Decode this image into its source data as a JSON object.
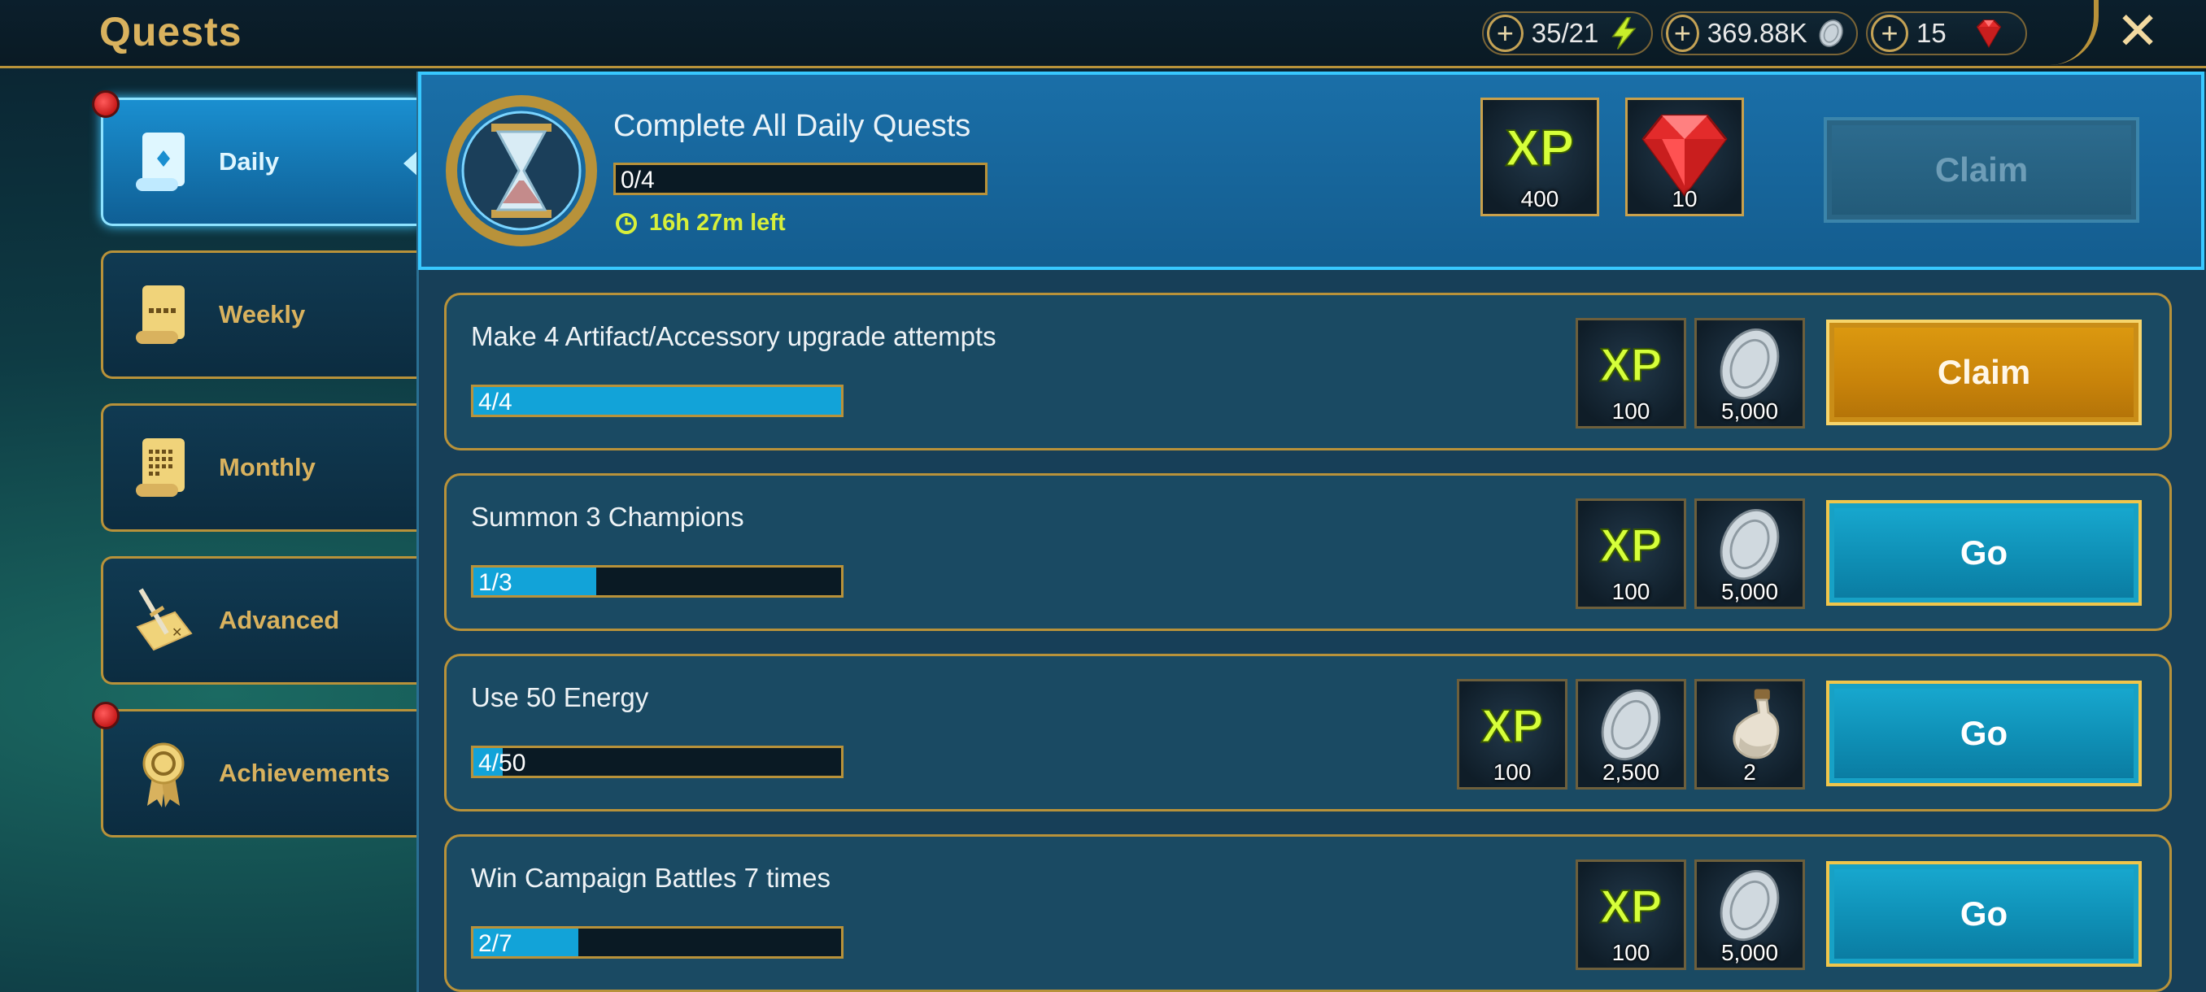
{
  "header": {
    "title": "Quests",
    "currencies": [
      {
        "value": "35/21",
        "icon": "energy-bolt-icon"
      },
      {
        "value": "369.88K",
        "icon": "silver-coin-icon"
      },
      {
        "value": "15",
        "icon": "ruby-gem-icon"
      }
    ],
    "close_icon": "close-icon",
    "plus_symbol": "+"
  },
  "sidebar": {
    "tabs": [
      {
        "label": "Daily",
        "active": true,
        "notification": true,
        "icon": "daily-scroll-icon"
      },
      {
        "label": "Weekly",
        "active": false,
        "notification": false,
        "icon": "weekly-scroll-icon"
      },
      {
        "label": "Monthly",
        "active": false,
        "notification": false,
        "icon": "monthly-scroll-icon"
      },
      {
        "label": "Advanced",
        "active": false,
        "notification": false,
        "icon": "advanced-sword-map-icon"
      },
      {
        "label": "Achievements",
        "active": false,
        "notification": true,
        "icon": "achievement-ribbon-icon"
      }
    ]
  },
  "daily_summary": {
    "title": "Complete All Daily Quests",
    "progress_text": "0/4",
    "progress_fraction": 0,
    "timer": "16h 27m left",
    "rewards": [
      {
        "type": "xp",
        "amount": "400",
        "icon": "xp-icon"
      },
      {
        "type": "gems",
        "amount": "10",
        "icon": "ruby-gem-icon"
      }
    ],
    "button_label": "Claim",
    "button_enabled": false
  },
  "quests": [
    {
      "title": "Make 4 Artifact/Accessory upgrade attempts",
      "progress_text": "4/4",
      "progress_fraction": 1.0,
      "rewards": [
        {
          "type": "xp",
          "amount": "100",
          "icon": "xp-icon"
        },
        {
          "type": "silver",
          "amount": "5,000",
          "icon": "silver-coin-icon"
        }
      ],
      "button_label": "Claim",
      "button_style": "claim"
    },
    {
      "title": "Summon 3 Champions",
      "progress_text": "1/3",
      "progress_fraction": 0.333,
      "rewards": [
        {
          "type": "xp",
          "amount": "100",
          "icon": "xp-icon"
        },
        {
          "type": "silver",
          "amount": "5,000",
          "icon": "silver-coin-icon"
        }
      ],
      "button_label": "Go",
      "button_style": "go"
    },
    {
      "title": "Use 50 Energy",
      "progress_text": "4/50",
      "progress_fraction": 0.08,
      "rewards": [
        {
          "type": "xp",
          "amount": "100",
          "icon": "xp-icon"
        },
        {
          "type": "silver",
          "amount": "2,500",
          "icon": "silver-coin-icon"
        },
        {
          "type": "potion",
          "amount": "2",
          "icon": "potion-bottle-icon"
        }
      ],
      "button_label": "Go",
      "button_style": "go"
    },
    {
      "title": "Win Campaign Battles 7 times",
      "progress_text": "2/7",
      "progress_fraction": 0.286,
      "rewards": [
        {
          "type": "xp",
          "amount": "100",
          "icon": "xp-icon"
        },
        {
          "type": "silver",
          "amount": "5,000",
          "icon": "silver-coin-icon"
        }
      ],
      "button_label": "Go",
      "button_style": "go"
    }
  ],
  "colors": {
    "gold_accent": "#b8923a",
    "title_gold": "#d9b25e",
    "progress_fill": "#12a3d8",
    "timer_green": "#d7ef3a",
    "claim_orange": "#dd9a10",
    "go_blue": "#18a9d0"
  }
}
